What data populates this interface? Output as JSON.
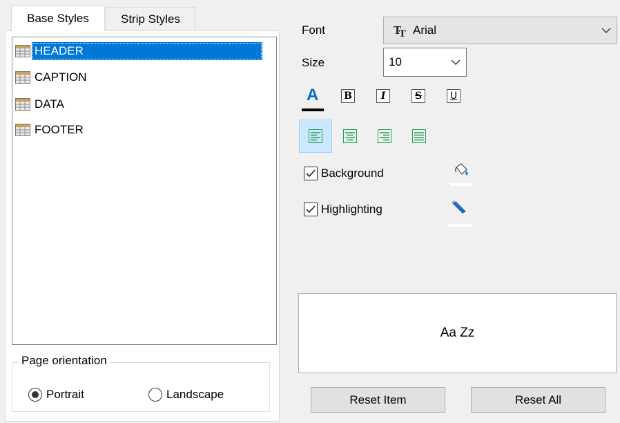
{
  "tabs": [
    {
      "label": "Base Styles",
      "active": true
    },
    {
      "label": "Strip Styles",
      "active": false
    }
  ],
  "style_list": {
    "items": [
      {
        "label": "HEADER",
        "selected": true,
        "icon": "grid-icon"
      },
      {
        "label": "CAPTION",
        "selected": false,
        "icon": "grid-icon"
      },
      {
        "label": "DATA",
        "selected": false,
        "icon": "grid-icon"
      },
      {
        "label": "FOOTER",
        "selected": false,
        "icon": "grid-icon"
      }
    ]
  },
  "page_orientation": {
    "title": "Page orientation",
    "options": [
      {
        "label": "Portrait",
        "selected": true
      },
      {
        "label": "Landscape",
        "selected": false
      }
    ]
  },
  "font": {
    "label": "Font",
    "value": "Arial",
    "icon": "truetype-font-icon"
  },
  "size": {
    "label": "Size",
    "value": "10"
  },
  "formatting": {
    "font_color_glyph": "A",
    "font_color": "#0070c0",
    "underline_color": "#000000",
    "bold_glyph": "B",
    "italic_glyph": "I",
    "strike_glyph": "S",
    "underline_glyph": "U"
  },
  "alignment": {
    "selected": "left",
    "options": [
      "left",
      "center",
      "right",
      "justify"
    ],
    "icon_color": "#1e9e5a"
  },
  "background": {
    "label": "Background",
    "checked": true,
    "icon": "paint-bucket-icon"
  },
  "highlighting": {
    "label": "Highlighting",
    "checked": true,
    "icon": "highlighter-icon"
  },
  "preview": {
    "text": "Aa Zz"
  },
  "buttons": {
    "reset_item": "Reset Item",
    "reset_all": "Reset All"
  },
  "colors": {
    "selection": "#0078d7",
    "window_bg": "#f0f0f0",
    "button_bg": "#e1e1e1"
  }
}
